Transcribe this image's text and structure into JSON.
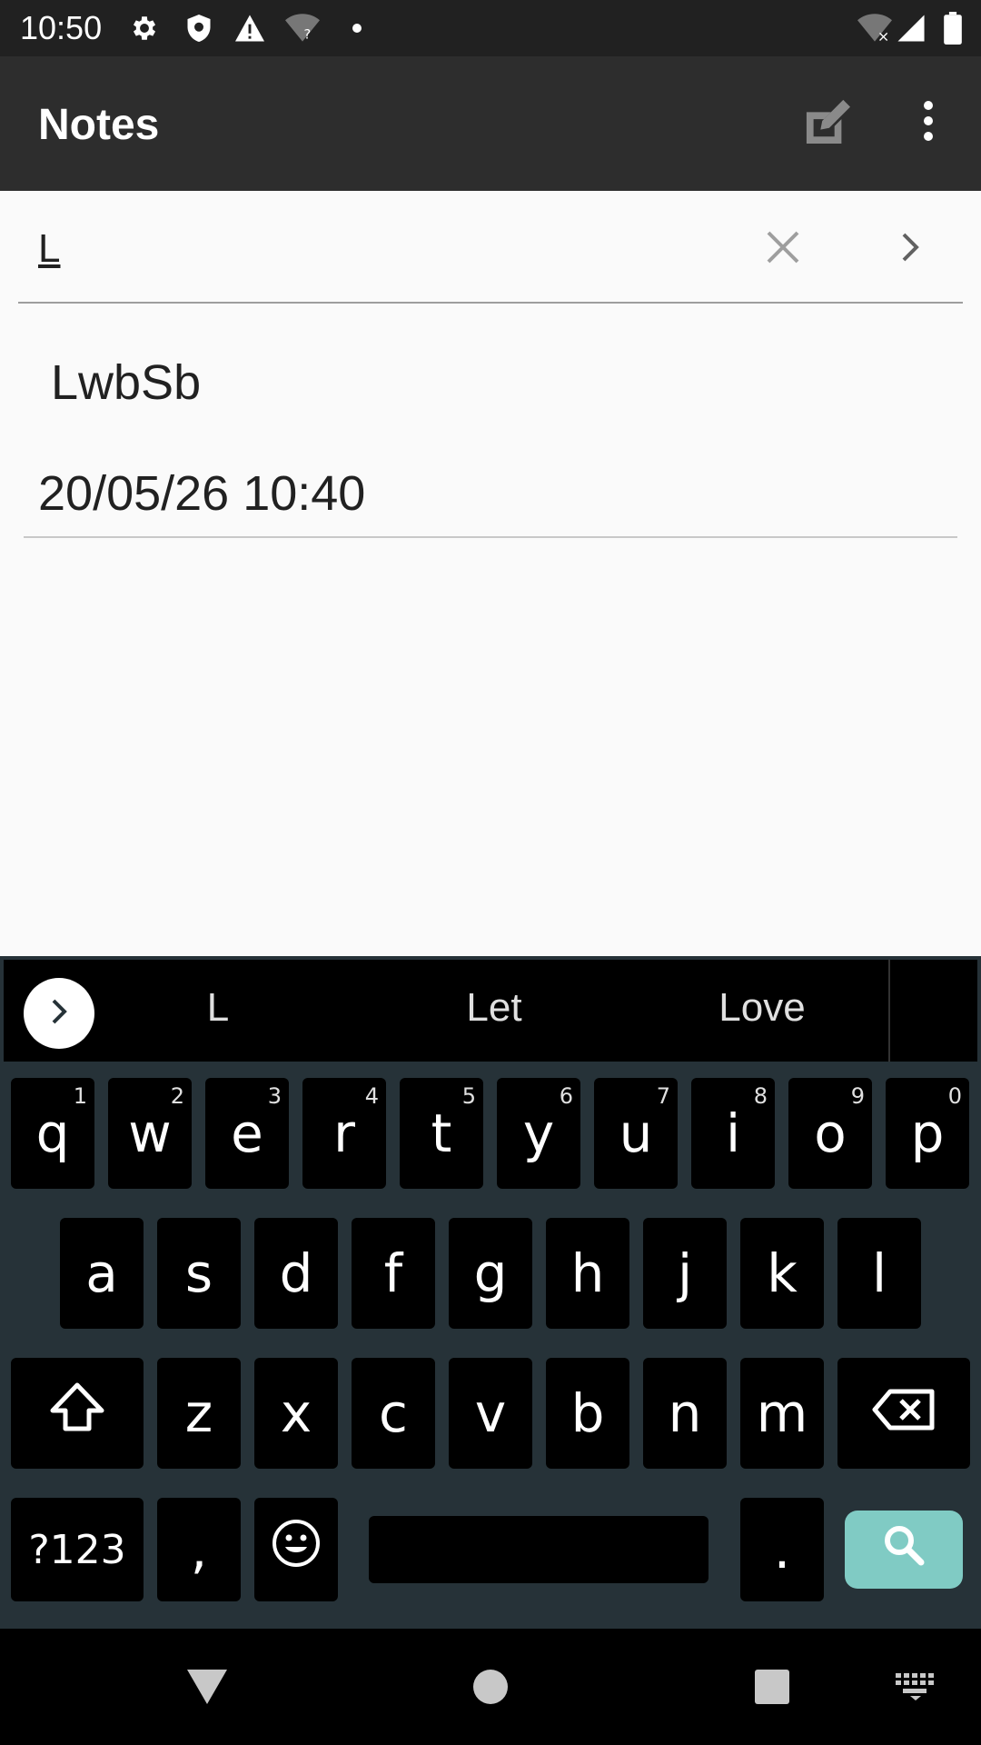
{
  "status_bar": {
    "time": "10:50",
    "icons": [
      "gear-icon",
      "shield-icon",
      "warning-icon",
      "wifi-question-icon",
      "dot-icon",
      "wifi-off-icon",
      "signal-icon",
      "battery-icon"
    ]
  },
  "app_bar": {
    "title": "Notes",
    "compose_icon": "compose-icon",
    "overflow_icon": "overflow-menu-icon"
  },
  "search": {
    "value": "L",
    "clear_icon": "close-icon",
    "go_icon": "chevron-right-icon"
  },
  "notes": [
    {
      "title": "LwbSb",
      "date": "20/05/26 10:40"
    }
  ],
  "keyboard": {
    "suggestions": [
      "L",
      "Let",
      "Love"
    ],
    "row1": [
      {
        "key": "q",
        "hint": "1"
      },
      {
        "key": "w",
        "hint": "2"
      },
      {
        "key": "e",
        "hint": "3"
      },
      {
        "key": "r",
        "hint": "4"
      },
      {
        "key": "t",
        "hint": "5"
      },
      {
        "key": "y",
        "hint": "6"
      },
      {
        "key": "u",
        "hint": "7"
      },
      {
        "key": "i",
        "hint": "8"
      },
      {
        "key": "o",
        "hint": "9"
      },
      {
        "key": "p",
        "hint": "0"
      }
    ],
    "row2": [
      "a",
      "s",
      "d",
      "f",
      "g",
      "h",
      "j",
      "k",
      "l"
    ],
    "row3": [
      "z",
      "x",
      "c",
      "v",
      "b",
      "n",
      "m"
    ],
    "symbols_label": "?123",
    "comma": ",",
    "period": ".",
    "action_color": "#80cbc4"
  },
  "nav_bar": {
    "icons": [
      "back-icon",
      "home-icon",
      "recents-icon",
      "keyboard-switch-icon"
    ]
  }
}
